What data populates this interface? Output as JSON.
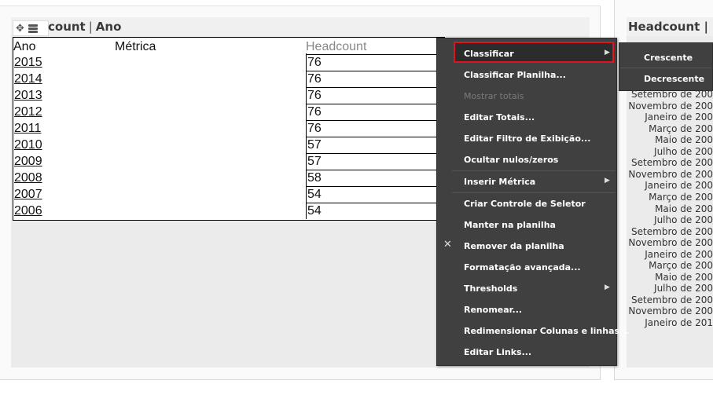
{
  "grid": {
    "title_part1": "count",
    "title_sep": "|",
    "title_part2": "Ano",
    "headers": {
      "ano": "Ano",
      "metrica": "Métrica",
      "headcount": "Headcount"
    },
    "rows": [
      {
        "year": "2015",
        "value": "76"
      },
      {
        "year": "2014",
        "value": "76"
      },
      {
        "year": "2013",
        "value": "76"
      },
      {
        "year": "2012",
        "value": "76"
      },
      {
        "year": "2011",
        "value": "76"
      },
      {
        "year": "2010",
        "value": "57"
      },
      {
        "year": "2009",
        "value": "57"
      },
      {
        "year": "2008",
        "value": "58"
      },
      {
        "year": "2007",
        "value": "54"
      },
      {
        "year": "2006",
        "value": "54"
      }
    ]
  },
  "right_panel": {
    "title": "Headcount |",
    "months": [
      "Setembro de 200",
      "Novembro de 200",
      "Janeiro de 200",
      "Março de 200",
      "Maio de 200",
      "Julho de 200",
      "Setembro de 200",
      "Novembro de 200",
      "Janeiro de 200",
      "Março de 200",
      "Maio de 200",
      "Julho de 200",
      "Setembro de 200",
      "Novembro de 200",
      "Janeiro de 200",
      "Março de 200",
      "Maio de 200",
      "Julho de 200",
      "Setembro de 200",
      "Novembro de 200",
      "Janeiro de 201"
    ]
  },
  "context_menu": {
    "items": [
      {
        "label": "Classificar",
        "enabled": true,
        "submenu": true
      },
      {
        "label": "Classificar Planilha...",
        "enabled": true
      },
      {
        "label": "Mostrar totais",
        "enabled": false
      },
      {
        "label": "Editar Totais...",
        "enabled": true
      },
      {
        "label": "Editar Filtro de Exibição...",
        "enabled": true
      },
      {
        "label": "Ocultar nulos/zeros",
        "enabled": true
      },
      {
        "label": "Inserir Métrica",
        "enabled": true,
        "submenu": true
      },
      {
        "label": "Criar Controle de Seletor",
        "enabled": true
      },
      {
        "label": "Manter na planilha",
        "enabled": true
      },
      {
        "label": "Remover da planilha",
        "enabled": true,
        "icon": "close-icon"
      },
      {
        "label": "Formatação avançada...",
        "enabled": true
      },
      {
        "label": "Thresholds",
        "enabled": true,
        "submenu": true
      },
      {
        "label": "Renomear...",
        "enabled": true
      },
      {
        "label": "Redimensionar Colunas e linhas...",
        "enabled": true
      },
      {
        "label": "Editar Links...",
        "enabled": true
      }
    ],
    "highlight_color": "#e0141e"
  },
  "submenu": {
    "items": [
      "Crescente",
      "Decrescente"
    ]
  },
  "colors": {
    "menu_bg": "#404040",
    "panel_bg": "#ebebeb",
    "highlight_border": "#e0141e"
  }
}
